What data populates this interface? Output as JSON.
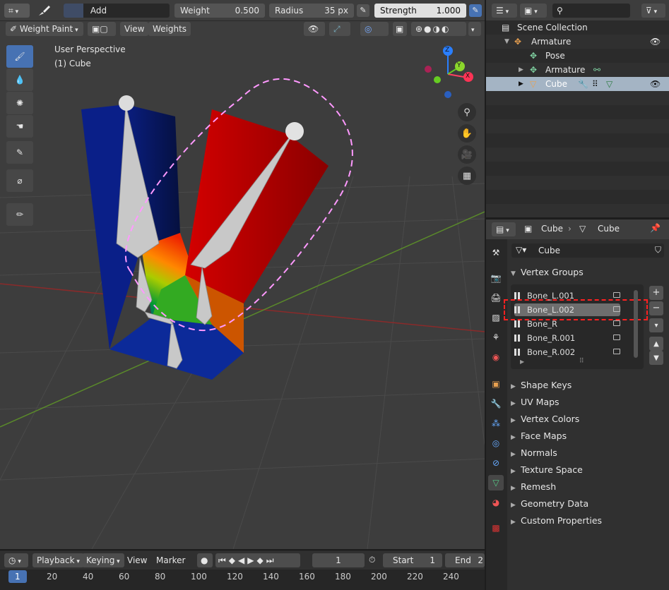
{
  "header": {
    "brush_mode": "Add",
    "weight_label": "Weight",
    "weight_value": "0.500",
    "radius_label": "Radius",
    "radius_value": "35 px",
    "strength_label": "Strength",
    "strength_value": "1.000"
  },
  "viewport_header": {
    "mode": "Weight Paint",
    "menu_view": "View",
    "menu_weights": "Weights"
  },
  "overlay_text": {
    "perspective": "User Perspective",
    "object": "(1) Cube"
  },
  "gizmo": {
    "z": "Z",
    "y": "Y",
    "x": "X"
  },
  "outliner": {
    "scene_collection": "Scene Collection",
    "rows": [
      {
        "label": "Armature"
      },
      {
        "label": "Pose"
      },
      {
        "label": "Armature"
      },
      {
        "label": "Cube"
      }
    ]
  },
  "properties": {
    "breadcrumb_object": "Cube",
    "breadcrumb_data": "Cube",
    "data_name": "Cube",
    "vertex_groups_title": "Vertex Groups",
    "vertex_groups": [
      "Bone_L.001",
      "Bone_L.002",
      "Bone_R",
      "Bone_R.001",
      "Bone_R.002"
    ],
    "selected_group_index": 1,
    "panels": [
      "Shape Keys",
      "UV Maps",
      "Vertex Colors",
      "Face Maps",
      "Normals",
      "Texture Space",
      "Remesh",
      "Geometry Data",
      "Custom Properties"
    ]
  },
  "timeline": {
    "playback": "Playback",
    "keying": "Keying",
    "view": "View",
    "marker": "Marker",
    "current_frame": "1",
    "start_label": "Start",
    "start_value": "1",
    "end_label": "End",
    "end_value": "2",
    "ruler": [
      "1",
      "20",
      "40",
      "60",
      "80",
      "100",
      "120",
      "140",
      "160",
      "180",
      "200",
      "220",
      "240"
    ]
  },
  "colors": {
    "accent": "#4772b3",
    "highlight_red": "#ff2020",
    "selection_dash": "#ff99ff"
  }
}
